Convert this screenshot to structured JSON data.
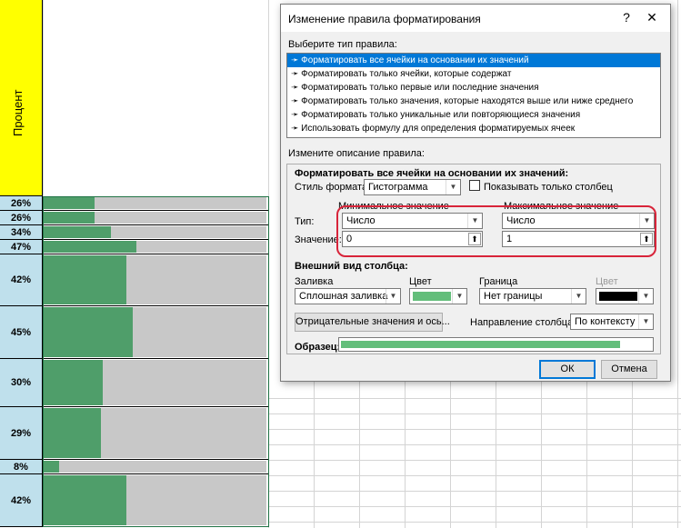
{
  "sheet": {
    "header_label": "Процент",
    "rows": [
      {
        "pct": "26%",
        "fraction": 0.26
      },
      {
        "pct": "26%",
        "fraction": 0.26
      },
      {
        "pct": "34%",
        "fraction": 0.34
      },
      {
        "pct": "47%",
        "fraction": 0.47
      },
      {
        "pct": "42%",
        "fraction": 0.42
      },
      {
        "pct": "45%",
        "fraction": 0.45
      },
      {
        "pct": "30%",
        "fraction": 0.3
      },
      {
        "pct": "29%",
        "fraction": 0.29
      },
      {
        "pct": "8%",
        "fraction": 0.08
      },
      {
        "pct": "42%",
        "fraction": 0.42
      }
    ],
    "colors": {
      "bar_fill": "#4f9e6a",
      "bar_bg": "#c8c8c8",
      "pct_bg": "#bfe0ec",
      "header_bg": "#ffff00"
    }
  },
  "dialog": {
    "title": "Изменение правила форматирования",
    "help": "?",
    "close": "✕",
    "choose_type_label": "Выберите тип правила:",
    "rule_types": [
      "Форматировать все ячейки на основании их значений",
      "Форматировать только ячейки, которые содержат",
      "Форматировать только первые или последние значения",
      "Форматировать только значения, которые находятся выше или ниже среднего",
      "Форматировать только уникальные или повторяющиеся значения",
      "Использовать формулу для определения форматируемых ячеек"
    ],
    "selected_rule_index": 0,
    "edit_desc_label": "Измените описание правила:",
    "format_all_label": "Форматировать все ячейки на основании их значений:",
    "style_label": "Стиль формата:",
    "style_value": "Гистограмма",
    "show_bar_only": "Показывать только столбец",
    "min_header": "Минимальное значение",
    "max_header": "Максимальное значение",
    "type_label": "Тип:",
    "value_label": "Значение:",
    "min_type": "Число",
    "max_type": "Число",
    "min_value": "0",
    "max_value": "1",
    "appearance_label": "Внешний вид столбца:",
    "fill_label": "Заливка",
    "fill_color_label": "Цвет",
    "border_label": "Граница",
    "border_color_label": "Цвет",
    "fill_value": "Сплошная заливка",
    "border_value": "Нет границы",
    "fill_color": "#63be7b",
    "border_color": "#000000",
    "negative_button": "Отрицательные значения и ось...",
    "direction_label": "Направление столбца:",
    "direction_value": "По контексту",
    "preview_label": "Образец:",
    "preview_fraction": 0.9,
    "ok": "ОК",
    "cancel": "Отмена"
  }
}
